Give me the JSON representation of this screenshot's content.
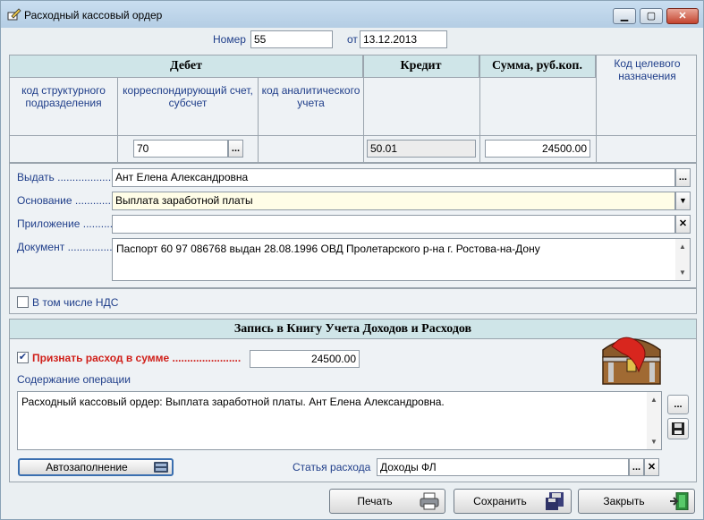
{
  "window": {
    "title": "Расходный кассовый ордер",
    "controls": {
      "minimize": "▁",
      "maximize": "▢",
      "close": "✕"
    }
  },
  "header": {
    "number_label": "Номер",
    "number_value": "55",
    "date_label": "от",
    "date_value": "13.12.2013"
  },
  "grid": {
    "debit_header": "Дебет",
    "credit_header": "Кредит",
    "sum_header": "Сумма, руб.коп.",
    "purpose_header": "Код целевого назначения",
    "debit_sub": {
      "struct_unit": "код структурного подразделения",
      "account": "корреспондирующий счет, субсчет",
      "analytic": "код аналитического учета"
    },
    "debit_account_value": "70",
    "credit_value": "50.01",
    "sum_value": "24500.00",
    "ellipsis": "..."
  },
  "form": {
    "issue_label": "Выдать",
    "issue_value": "Ант Елена Александровна",
    "basis_label": "Основание",
    "basis_value": "Выплата  заработной платы",
    "attachment_label": "Приложение",
    "attachment_value": "",
    "document_label": "Документ",
    "document_value": "Паспорт 60 97 086768 выдан 28.08.1996 ОВД Пролетарского р-на г. Ростова-на-Дону",
    "vat_label": "В том числе НДС",
    "vat_checked": false,
    "leader_dots": "......................."
  },
  "book": {
    "title": "Запись в Книгу Учета Доходов и Расходов",
    "recognize_label": "Признать расход в сумме",
    "recognize_checked": true,
    "recognize_value": "24500.00",
    "content_label": "Содержание операции",
    "content_value": "Расходный кассовый ордер: Выплата  заработной платы. Ант Елена Александровна.",
    "autofill_label": "Автозаполнение",
    "expense_item_label": "Статья расхода",
    "expense_item_value": "Доходы ФЛ"
  },
  "footer": {
    "print_label": "Печать",
    "save_label": "Сохранить",
    "close_label": "Закрыть"
  },
  "icons": {
    "app": "pencil-edit-icon",
    "treasure": "treasure-chest-icon",
    "print": "printer-icon",
    "save": "floppy-save-icon",
    "close": "exit-door-icon"
  },
  "colors": {
    "label_blue": "#1f3e8a",
    "header_teal": "#cfe5e8",
    "accent_red": "#d0201a",
    "basis_yellow": "#fffde7"
  }
}
